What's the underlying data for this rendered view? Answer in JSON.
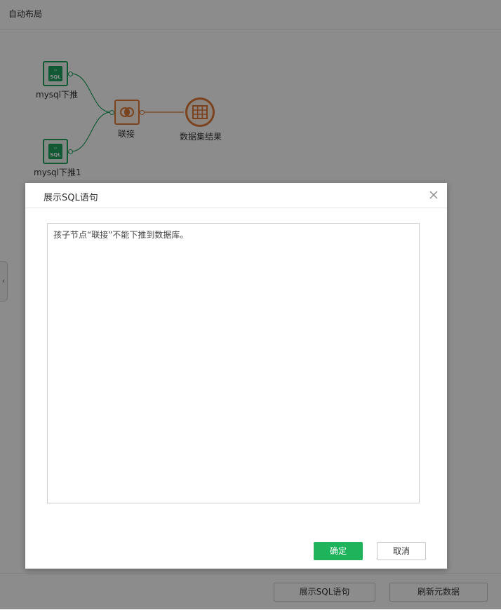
{
  "topbar": {
    "title": "自动布局"
  },
  "flow": {
    "nodes": {
      "mysql_a": {
        "label": "mysql下推",
        "icon": "sql-table-icon"
      },
      "mysql_b": {
        "label": "mysql下推1",
        "icon": "sql-table-icon"
      },
      "join": {
        "label": "联接",
        "icon": "join-icon"
      },
      "result": {
        "label": "数据集结果",
        "icon": "table-grid-icon"
      }
    },
    "colors": {
      "source": "#1fa361",
      "join": "#e07b39"
    }
  },
  "bottom": {
    "show_sql_label": "展示SQL语句",
    "refresh_meta_label": "刷新元数据"
  },
  "dialog": {
    "title": "展示SQL语句",
    "message": "孩子节点“联接”不能下推到数据库。",
    "ok_label": "确定",
    "cancel_label": "取消",
    "ok_color": "#1fb35b"
  }
}
